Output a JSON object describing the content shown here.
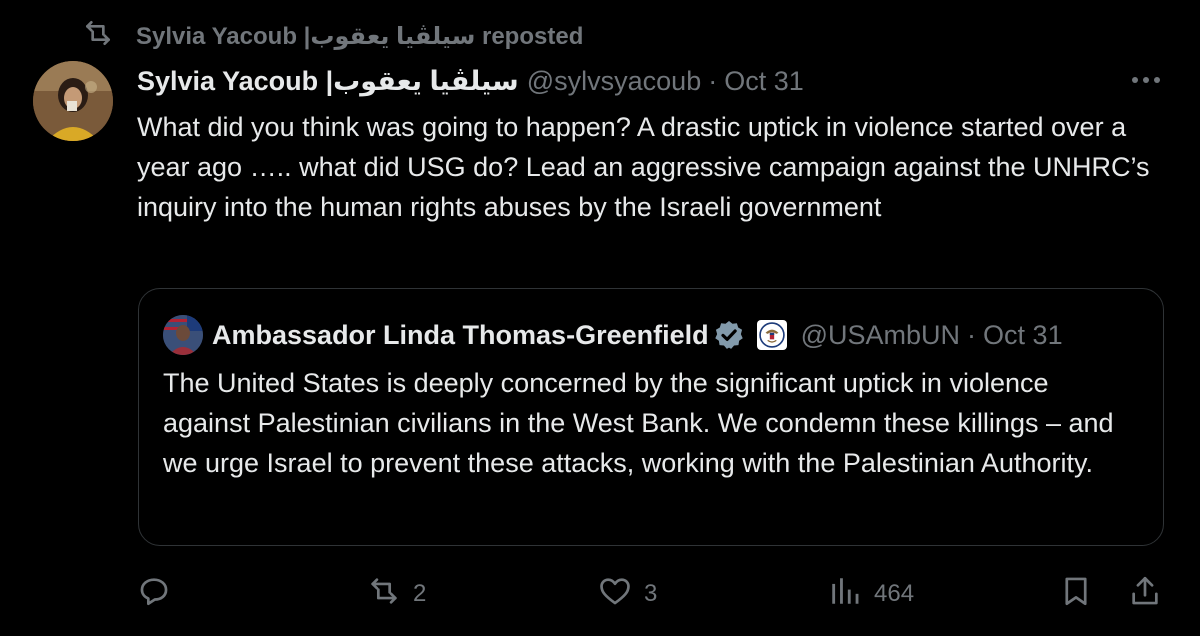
{
  "repost": {
    "text": "Sylvia Yacoub |سيلڤيا يعقوب reposted"
  },
  "tweet": {
    "name": "Sylvia Yacoub |سيلڤيا يعقوب",
    "handle": "@sylvsyacoub",
    "separator": "·",
    "date": "Oct 31",
    "text": "What did you think was going to happen? A drastic uptick in violence started over a year ago ….. what did USG do? Lead an aggressive campaign against the UNHRC’s inquiry into the human rights abuses by the Israeli government"
  },
  "quote": {
    "name": "Ambassador Linda Thomas-Greenfield",
    "handle": "@USAmbUN",
    "separator": "·",
    "date": "Oct 31",
    "text": "The United States is deeply concerned by the significant uptick in violence against Palestinian civilians in the West Bank. We condemn these killings – and we urge Israel to prevent these attacks, working with the Palestinian Authority."
  },
  "actions": {
    "reply": {
      "icon": "reply-icon",
      "count": ""
    },
    "repost": {
      "icon": "repost-icon",
      "count": "2"
    },
    "like": {
      "icon": "heart-icon",
      "count": "3"
    },
    "views": {
      "icon": "views-icon",
      "count": "464"
    },
    "bookmark": {
      "icon": "bookmark-icon"
    },
    "share": {
      "icon": "share-icon"
    }
  },
  "colors": {
    "background": "#000000",
    "text": "#e7e9ea",
    "muted": "#71767b",
    "border": "#2f3336",
    "verified": "#829aab"
  }
}
